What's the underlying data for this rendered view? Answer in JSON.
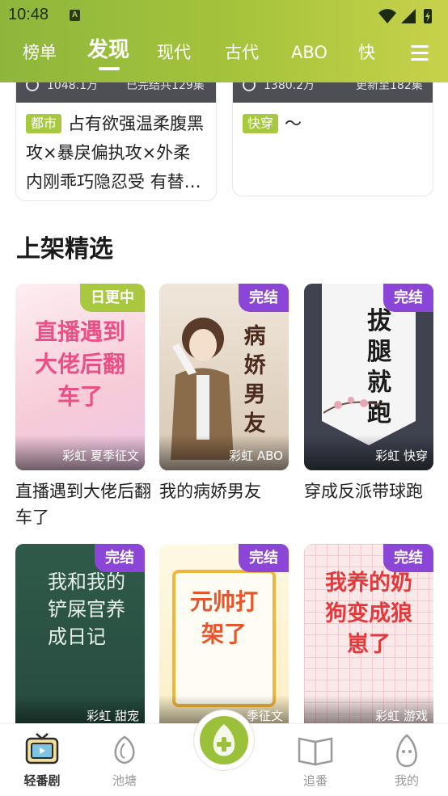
{
  "status": {
    "time": "10:48",
    "notif_glyph": "A"
  },
  "tabs": [
    {
      "label": "榜单"
    },
    {
      "label": "发现",
      "active": true
    },
    {
      "label": "现代"
    },
    {
      "label": "古代"
    },
    {
      "label": "ABO"
    },
    {
      "label": "快"
    }
  ],
  "top_cards": [
    {
      "views": "1048.1万",
      "status": "已完结共129集",
      "tag": "都市",
      "desc": "占有欲强温柔腹黑攻×暴戾偏执攻×外柔内刚乖巧隐忍受 有替…"
    },
    {
      "views": "1380.2万",
      "status": "更新至182集",
      "tag": "快穿",
      "desc": "～"
    }
  ],
  "section": {
    "title": "上架精选"
  },
  "books": [
    {
      "name": "直播遇到大佬后翻车了",
      "badge": "日更中",
      "meta": "彩虹 夏季征文",
      "cover_text": "直播遇到大佬后翻车了",
      "bg": "#fbe3ea"
    },
    {
      "name": "我的病娇男友",
      "badge": "完结",
      "meta": "彩虹 ABO",
      "cover_text": "病娇男友",
      "bg": "#e9ddd0"
    },
    {
      "name": "穿成反派带球跑",
      "badge": "完结",
      "meta": "彩虹 快穿",
      "cover_text": "拔腿就跑",
      "bg": "#3f4350"
    },
    {
      "name": "",
      "badge": "完结",
      "meta": "彩虹 甜宠",
      "cover_text": "我和我的铲屎官养成日记",
      "bg": "#2f5a4a"
    },
    {
      "name": "",
      "badge": "完结",
      "meta": "季征文",
      "cover_text": "元帅打架了",
      "bg": "#fdf6d6"
    },
    {
      "name": "",
      "badge": "完结",
      "meta": "彩虹 游戏",
      "cover_text": "我养的奶狗变成狼崽了",
      "bg": "#fbe9ea"
    }
  ],
  "bottom_nav": [
    {
      "label": "轻番剧",
      "icon": "tv-icon",
      "active": true
    },
    {
      "label": "池塘",
      "icon": "pond-icon"
    },
    {
      "label": "",
      "icon": "pear-plus-icon"
    },
    {
      "label": "追番",
      "icon": "book-icon"
    },
    {
      "label": "我的",
      "icon": "pear-face-icon"
    }
  ],
  "colors": {
    "accent": "#a8c93f",
    "done_badge": "#8b46d8",
    "header_start": "#8fb63b",
    "header_end": "#c7d24a"
  }
}
